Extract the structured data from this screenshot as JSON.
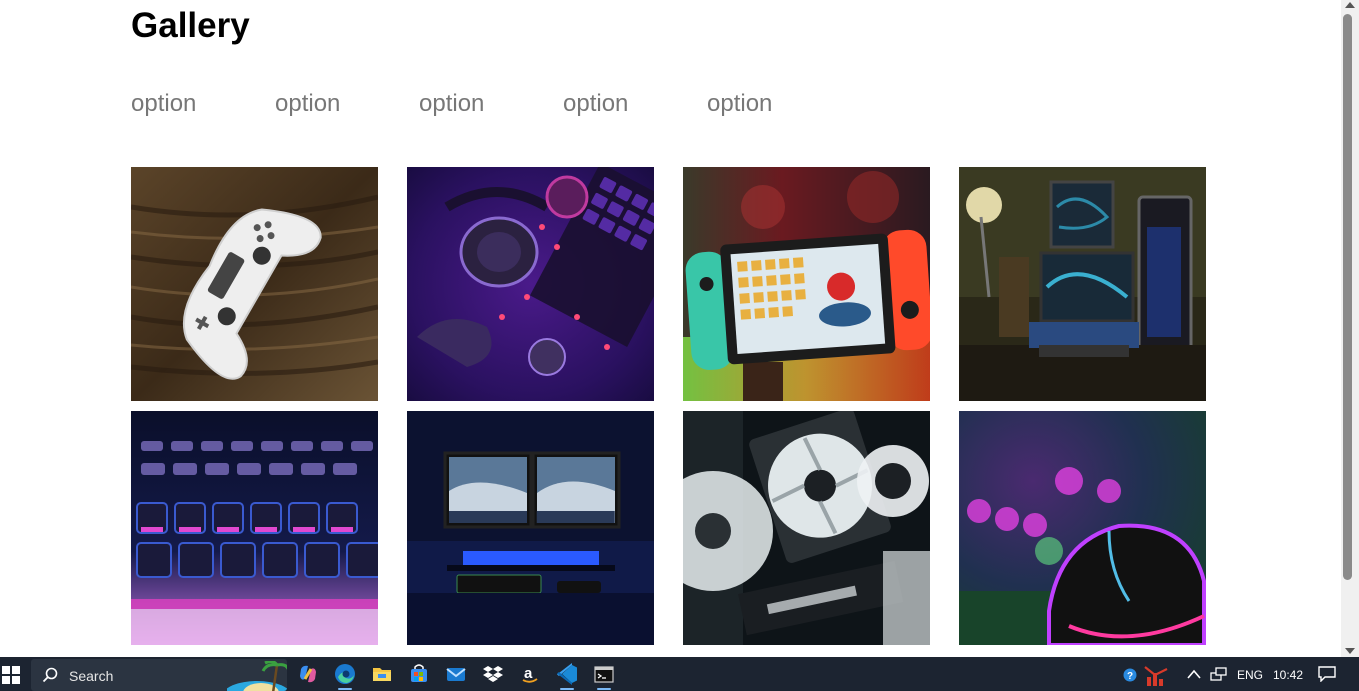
{
  "header": {
    "title": "Gallery"
  },
  "filters": [
    "option",
    "option",
    "option",
    "option",
    "option"
  ],
  "gallery": {
    "items": [
      {
        "name": "gamepad-on-wood-image"
      },
      {
        "name": "neon-headset-desk-image"
      },
      {
        "name": "handheld-console-image"
      },
      {
        "name": "gaming-setup-room-image"
      },
      {
        "name": "rgb-keyboard-closeup-image"
      },
      {
        "name": "dual-monitor-setup-image"
      },
      {
        "name": "pc-fans-gpu-image"
      },
      {
        "name": "rgb-mouse-image"
      }
    ]
  },
  "taskbar": {
    "search_label": "Search",
    "language": "ENG",
    "time": "10:42"
  }
}
